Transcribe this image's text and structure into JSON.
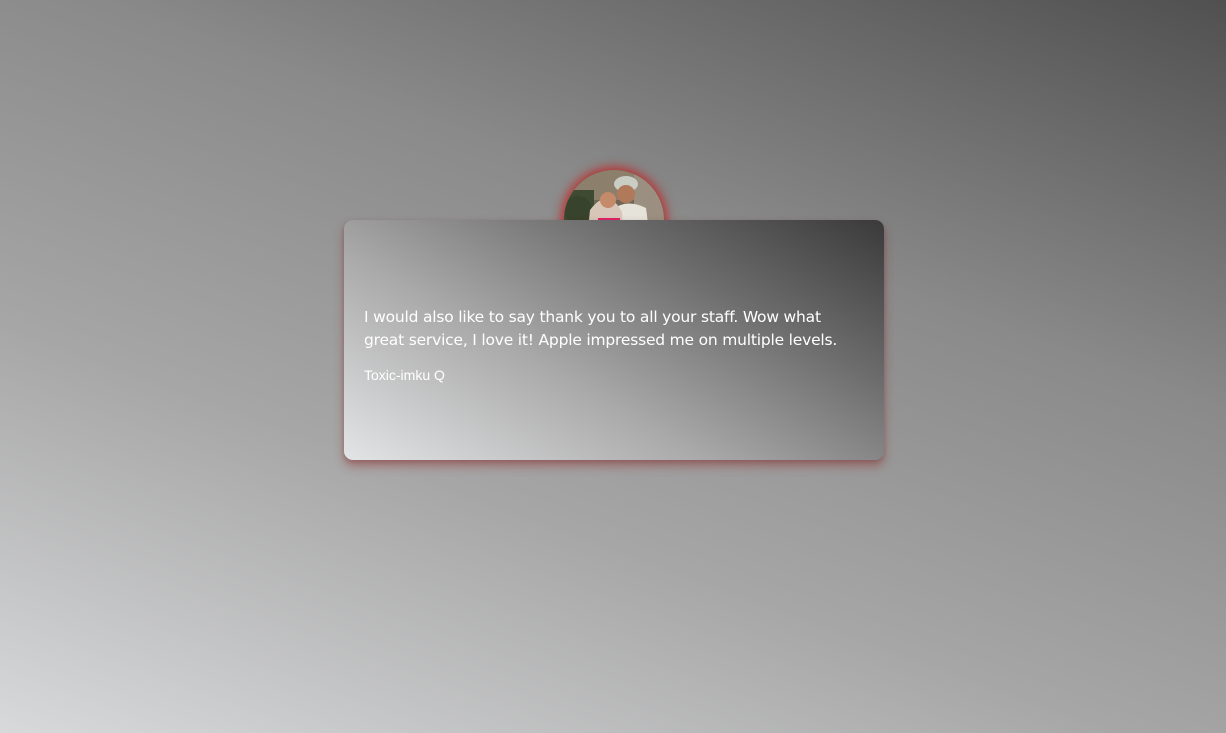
{
  "testimonial": {
    "quote": "I would also like to say thank you to all your staff. Wow what great service, I love it! Apple impressed me on multiple levels.",
    "author": "Toxic-imku Q",
    "avatar_icon": "couple-photo-avatar"
  },
  "colors": {
    "avatar_glow": "#c81414",
    "text": "#ffffff"
  }
}
